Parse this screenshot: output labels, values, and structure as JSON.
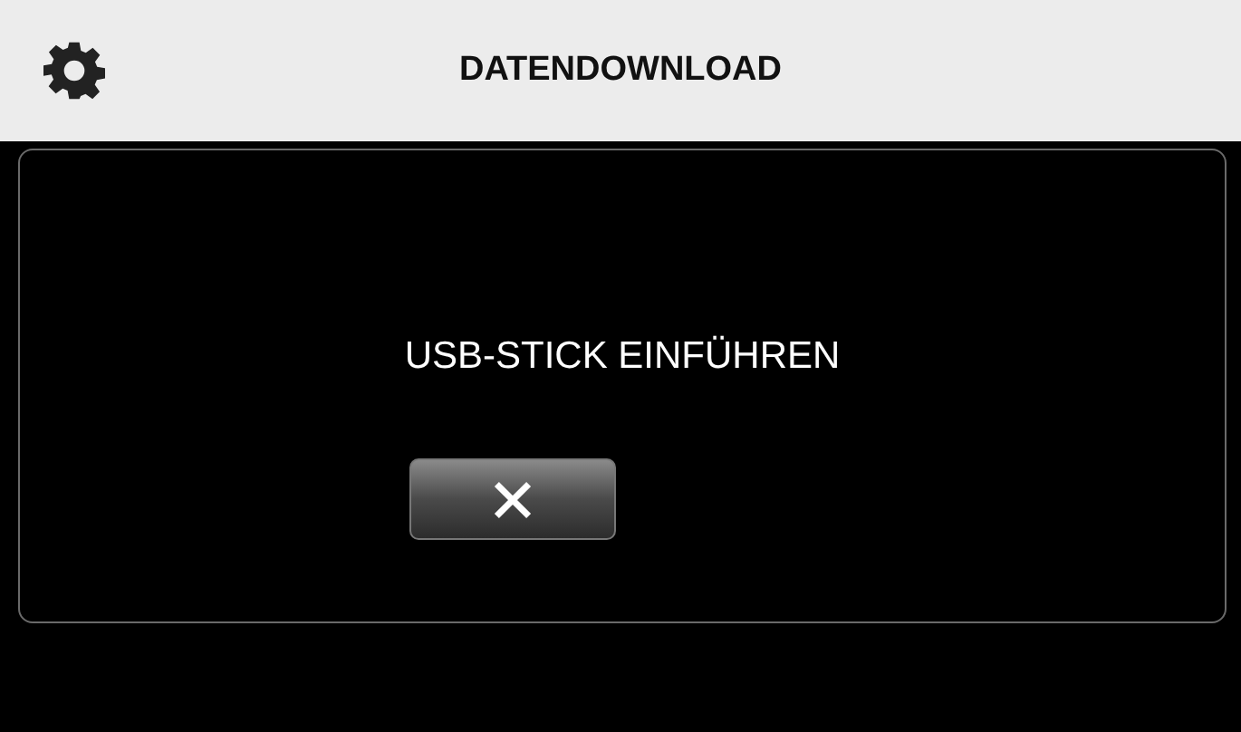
{
  "header": {
    "title": "DATENDOWNLOAD"
  },
  "dialog": {
    "message": "USB-STICK EINFÜHREN",
    "buttons": [
      {
        "kind": "cancel"
      }
    ]
  }
}
